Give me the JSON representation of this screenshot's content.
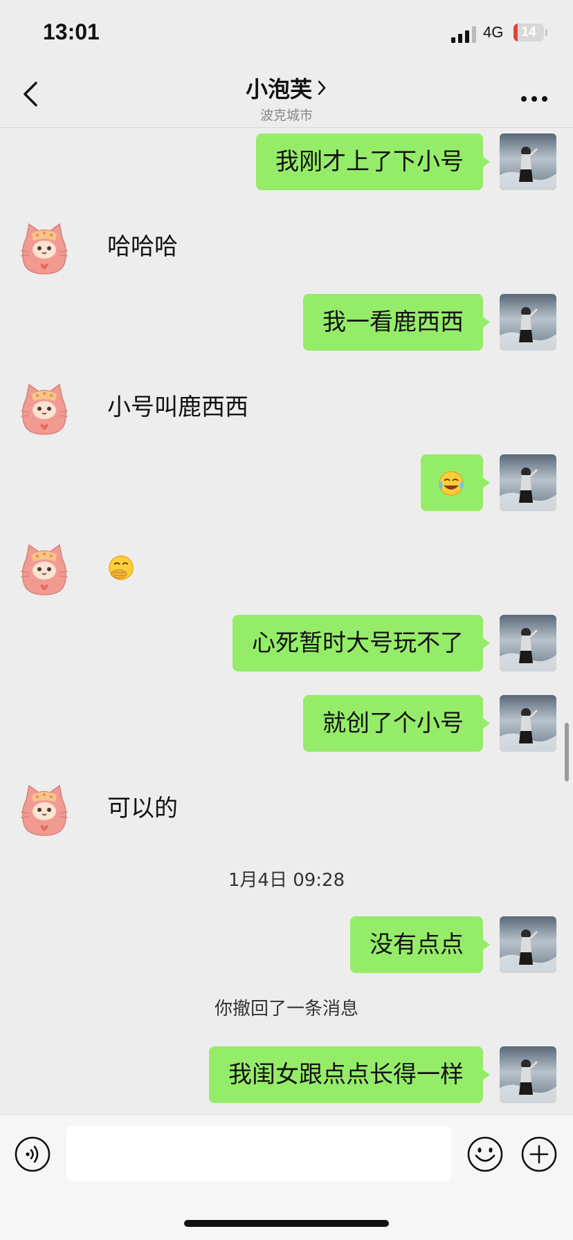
{
  "status_bar": {
    "time": "13:01",
    "network": "4G",
    "battery": "14",
    "battery_level": 0.14
  },
  "header": {
    "title": "小泡芙",
    "subtitle": "波克城市"
  },
  "messages": [
    {
      "side": "right",
      "text": "我刚才上了下小号"
    },
    {
      "side": "left",
      "text": "哈哈哈"
    },
    {
      "side": "right",
      "text": "我一看鹿西西"
    },
    {
      "side": "left",
      "text": "小号叫鹿西西"
    },
    {
      "side": "right",
      "emoji": "laughing-crying-emoji"
    },
    {
      "side": "left",
      "emoji": "hand-over-mouth-emoji"
    },
    {
      "side": "right",
      "text": "心死暂时大号玩不了"
    },
    {
      "side": "right",
      "text": "就创了个小号"
    },
    {
      "side": "left",
      "text": "可以的"
    },
    {
      "side": "right",
      "text": "没有点点"
    },
    {
      "side": "right",
      "text": "我闺女跟点点长得一样"
    }
  ],
  "system": {
    "timestamp": "1月4日 09:28",
    "recall_notice": "你撤回了一条消息"
  },
  "input": {
    "value": ""
  },
  "colors": {
    "bubble_right": "#95ec69",
    "background": "#ededed"
  }
}
